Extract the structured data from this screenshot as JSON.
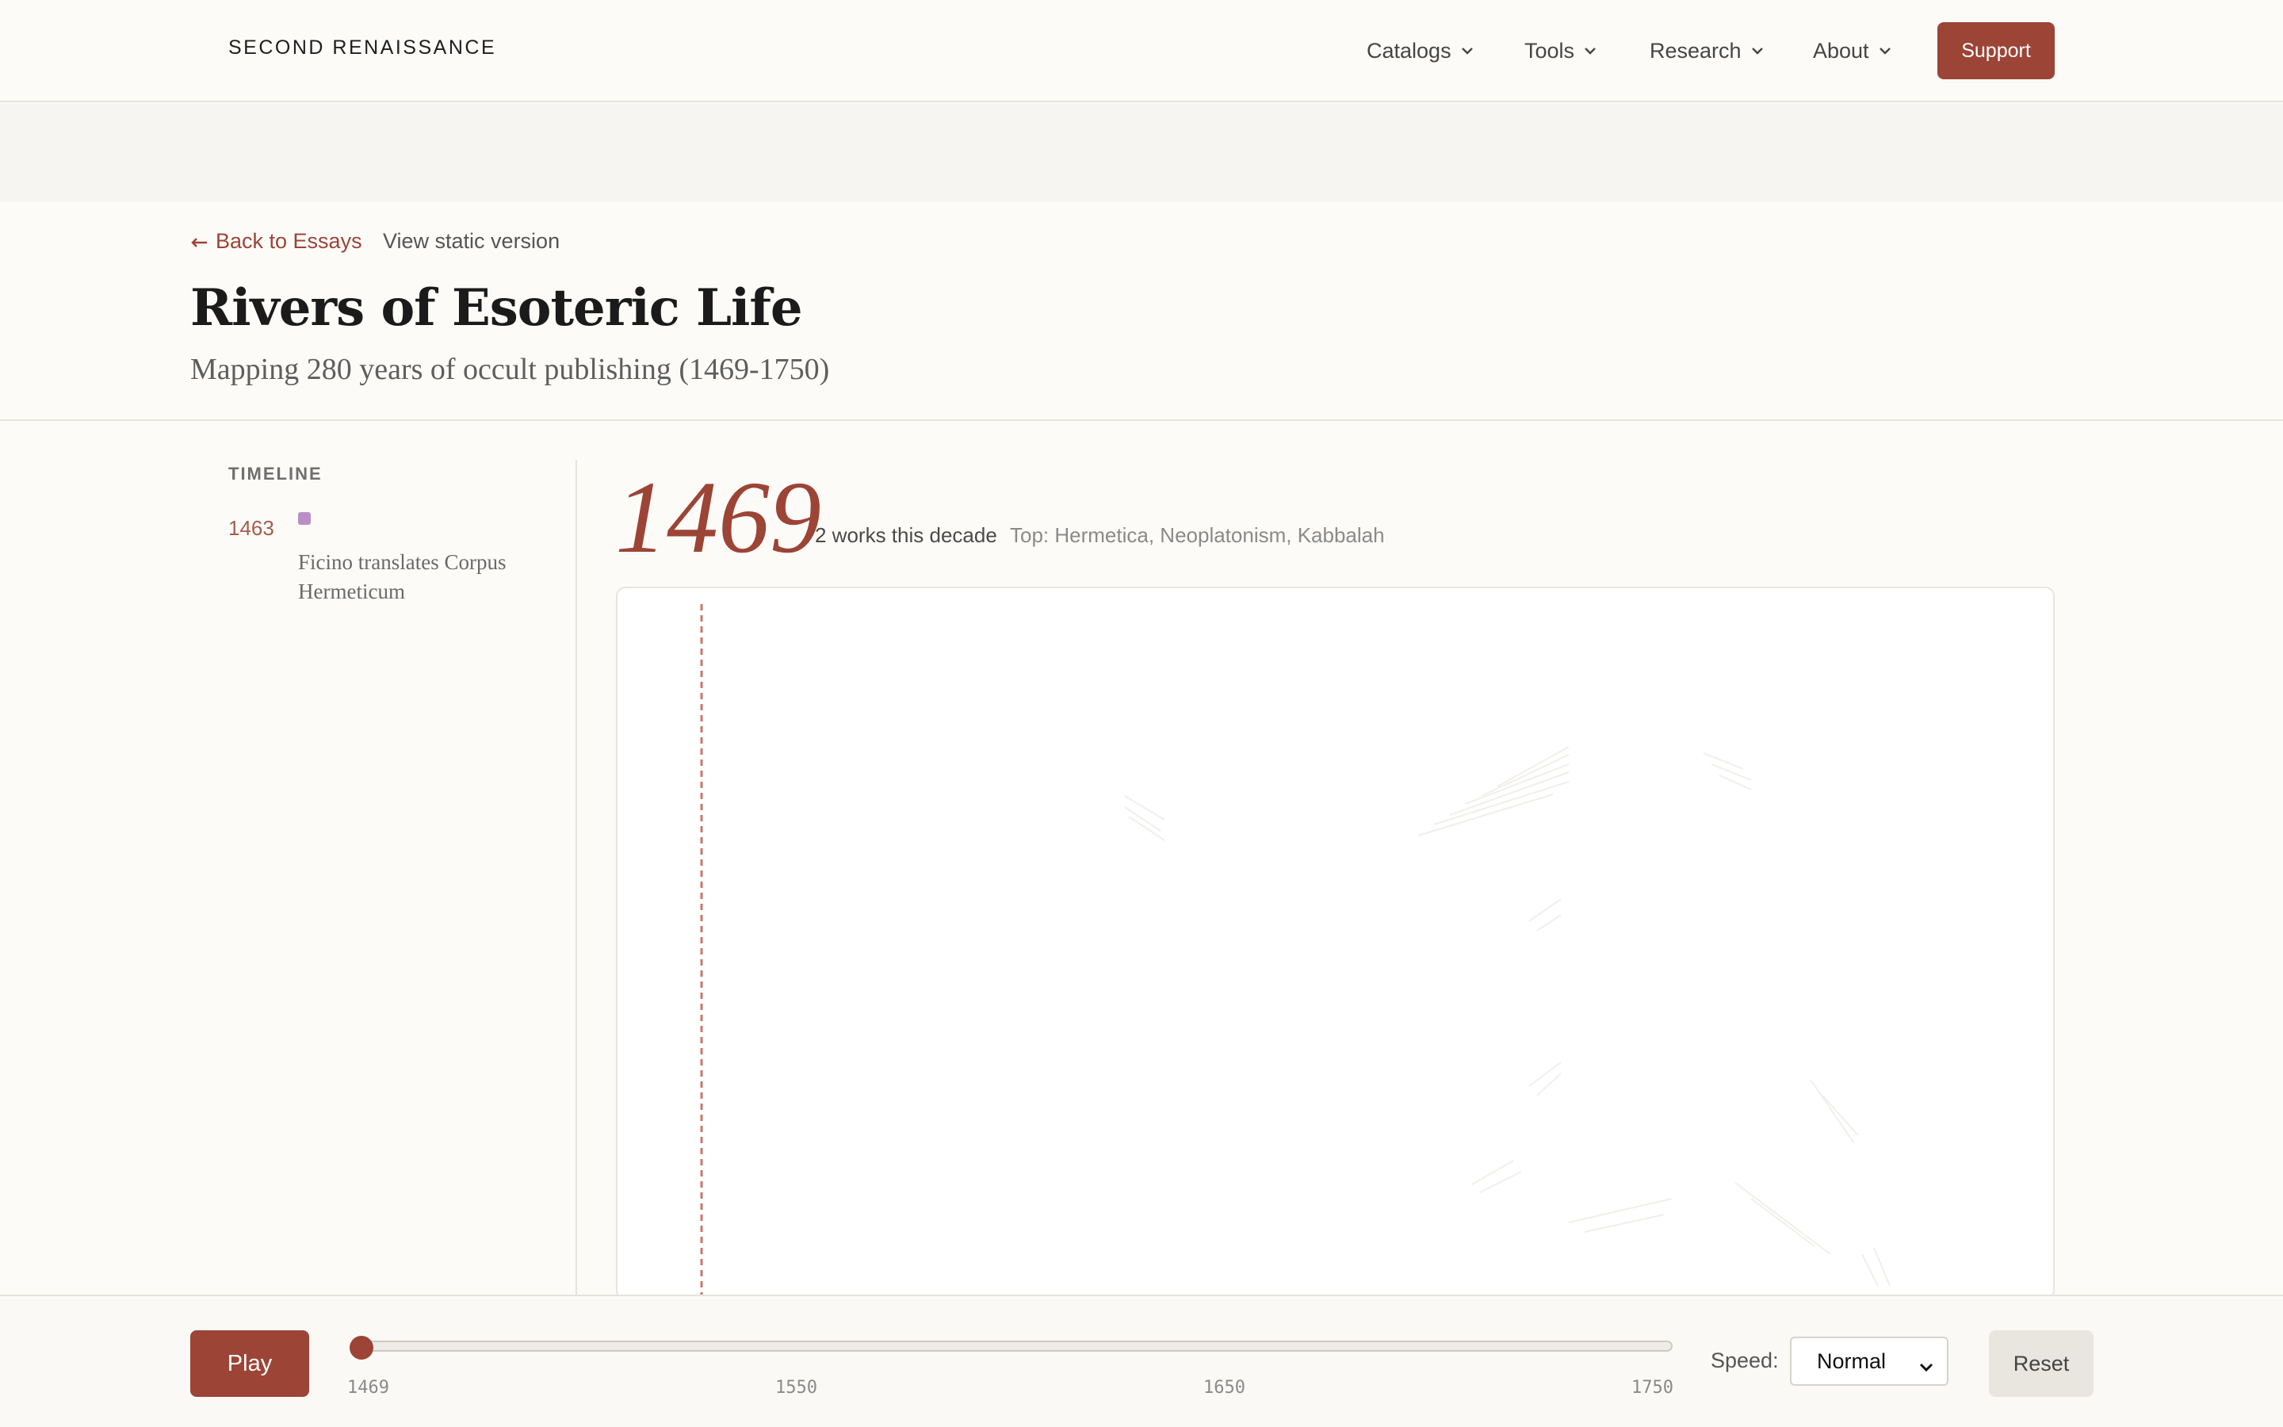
{
  "brand": "SECOND RENAISSANCE",
  "nav": {
    "items": [
      {
        "label": "Catalogs"
      },
      {
        "label": "Tools"
      },
      {
        "label": "Research"
      },
      {
        "label": "About"
      }
    ],
    "support_label": "Support"
  },
  "essay": {
    "back_label": "Back to Essays",
    "static_label": "View static version",
    "title": "Rivers of Esoteric Life",
    "subtitle": "Mapping 280 years of occult publishing (1469-1750)"
  },
  "timeline": {
    "heading": "TIMELINE",
    "events": [
      {
        "year": "1463",
        "text": "Ficino translates Corpus Hermeticum",
        "color": "#b98fc6"
      }
    ]
  },
  "viz": {
    "current_year": "1469",
    "works_count": "2 works this decade",
    "top_topics": "Top: Hermetica, Neoplatonism, Kabbalah",
    "marker_color": "#c9786a"
  },
  "controls": {
    "play_label": "Play",
    "slider": {
      "min": 1469,
      "max": 1750,
      "value": 1469
    },
    "ticks": [
      "1469",
      "1550",
      "1650",
      "1750"
    ],
    "speed_label": "Speed:",
    "speed_value": "Normal",
    "reset_label": "Reset"
  },
  "colors": {
    "accent": "#9c4436",
    "background": "#fcfbf8"
  }
}
